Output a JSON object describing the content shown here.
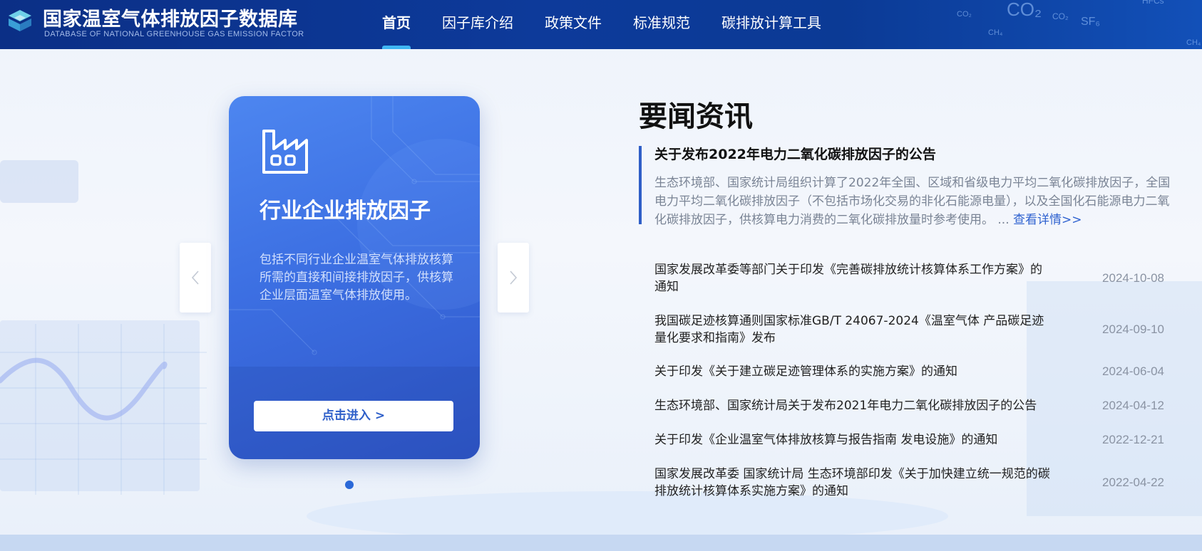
{
  "header": {
    "title": "国家温室气体排放因子数据库",
    "subtitle": "DATABASE OF NATIONAL GREENHOUSE GAS EMISSION FACTOR",
    "deco_labels": [
      "CO₂",
      "CO₂",
      "CO₂",
      "SF₆",
      "CH₄",
      "HFCs",
      "CH₄"
    ]
  },
  "nav": {
    "items": [
      {
        "label": "首页",
        "active": true
      },
      {
        "label": "因子库介绍",
        "active": false
      },
      {
        "label": "政策文件",
        "active": false
      },
      {
        "label": "标准规范",
        "active": false
      },
      {
        "label": "碳排放计算工具",
        "active": false
      }
    ]
  },
  "carousel": {
    "card": {
      "icon": "factory-icon",
      "title": "行业企业排放因子",
      "description": "包括不同行业企业温室气体排放核算所需的直接和间接排放因子，供核算企业层面温室气体排放使用。",
      "button_label": "点击进入 >"
    },
    "prev_icon": "chevron-left-icon",
    "next_icon": "chevron-right-icon",
    "dot_count": 1
  },
  "news": {
    "heading": "要闻资讯",
    "featured": {
      "title": "关于发布2022年电力二氧化碳排放因子的公告",
      "summary": "生态环境部、国家统计局组织计算了2022年全国、区域和省级电力平均二氧化碳排放因子，全国电力平均二氧化碳排放因子（不包括市场化交易的非化石能源电量），以及全国化石能源电力二氧化碳排放因子，供核算电力消费的二氧化碳排放量时参考使用。 ...",
      "more_label": "查看详情>>"
    },
    "items": [
      {
        "title": "国家发展改革委等部门关于印发《完善碳排放统计核算体系工作方案》的通知",
        "date": "2024-10-08"
      },
      {
        "title": "我国碳足迹核算通则国家标准GB/T 24067-2024《温室气体 产品碳足迹 量化要求和指南》发布",
        "date": "2024-09-10"
      },
      {
        "title": "关于印发《关于建立碳足迹管理体系的实施方案》的通知",
        "date": "2024-06-04"
      },
      {
        "title": "生态环境部、国家统计局关于发布2021年电力二氧化碳排放因子的公告",
        "date": "2024-04-12"
      },
      {
        "title": "关于印发《企业温室气体排放核算与报告指南 发电设施》的通知",
        "date": "2022-12-21"
      },
      {
        "title": "国家发展改革委 国家统计局 生态环境部印发《关于加快建立统一规范的碳排放统计核算体系实施方案》的通知",
        "date": "2022-04-22"
      }
    ]
  },
  "colors": {
    "header_bg": "#0d3a9a",
    "nav_active_underline": "#3fb6f2",
    "card_bg": "#3c6fe2",
    "link": "#2f62d0",
    "accent_bar": "#2f5fc7"
  }
}
